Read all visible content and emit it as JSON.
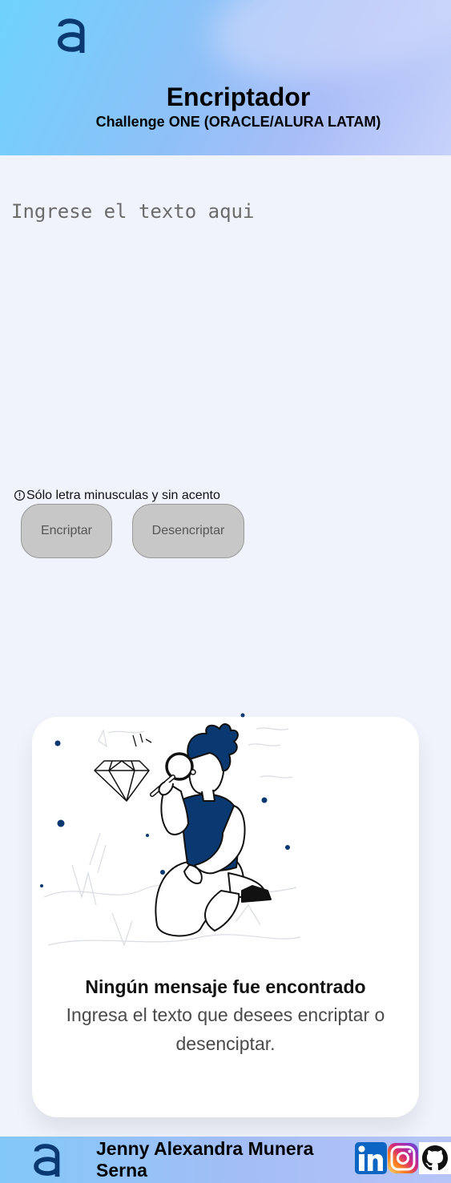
{
  "header": {
    "title": "Encriptador",
    "subtitle": "Challenge ONE (ORACLE/ALURA LATAM)",
    "logo_icon": "alura-logo-icon"
  },
  "input": {
    "placeholder": "Ingrese el texto aqui",
    "value": ""
  },
  "hint": {
    "icon": "info-circle-icon",
    "text": "Sólo letra minusculas y sin acento"
  },
  "buttons": {
    "encrypt_label": "Encriptar",
    "decrypt_label": "Desencriptar"
  },
  "result": {
    "illustration": "person-magnifying-glass-illustration",
    "title": "Ningún mensaje fue encontrado",
    "text": "Ingresa el texto que desees encriptar o desenciptar."
  },
  "footer": {
    "author": "Jenny Alexandra Munera Serna",
    "social": [
      "linkedin-icon",
      "instagram-icon",
      "github-icon"
    ]
  },
  "colors": {
    "brand_dark_blue": "#0A3871",
    "background": "#F0F2FC",
    "button_gray": "#C7C7C7"
  }
}
